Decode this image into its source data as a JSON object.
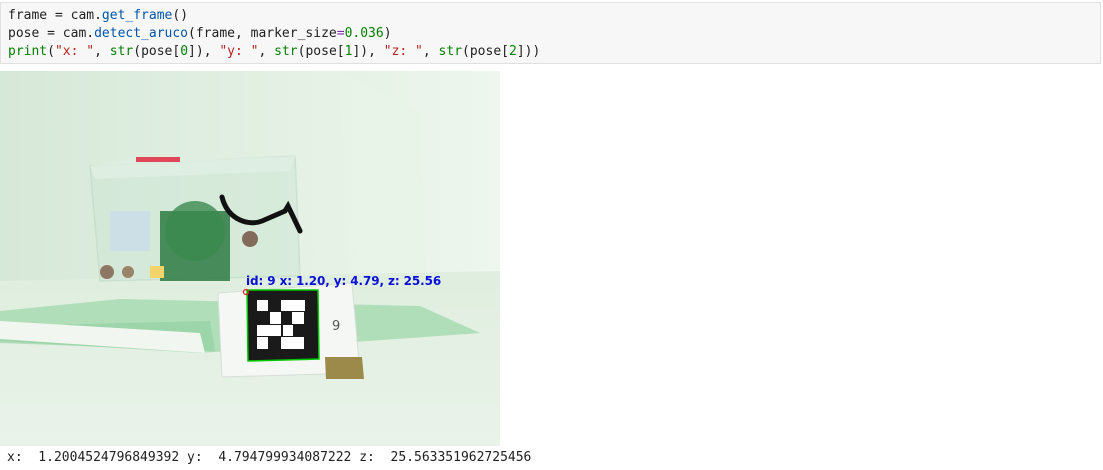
{
  "code_cell": {
    "line1": {
      "a": "frame = cam.",
      "fn": "get_frame",
      "b": "()"
    },
    "line2": {
      "a": "pose = cam.",
      "fn": "detect_aruco",
      "b": "(frame, marker_size",
      "eq": "=",
      "num": "0.036",
      "c": ")"
    },
    "line3": {
      "print": "print",
      "p1": "(",
      "s1": "\"x: \"",
      "c1": ", ",
      "str1": "str",
      "a1": "(pose[",
      "n0": "0",
      "b1": "]), ",
      "s2": "\"y: \"",
      "c2": ", ",
      "str2": "str",
      "a2": "(pose[",
      "n1": "1",
      "b2": "]), ",
      "s3": "\"z: \"",
      "c3": ", ",
      "str3": "str",
      "a3": "(pose[",
      "n2": "2",
      "b3": "]))"
    }
  },
  "image": {
    "overlay_label": "id: 9 x: 1.20, y: 4.79, z: 25.56",
    "card_digit": "9"
  },
  "output": {
    "text": "x:  1.2004524796849392 y:  4.794799934087222 z:  25.563351962725456"
  },
  "colors": {
    "code_bg": "#f7f7f7",
    "function": "#0055aa",
    "string": "#ba2121",
    "number": "#008000",
    "overlay_text": "#0a10d8",
    "marker_outline": "#00c800"
  }
}
